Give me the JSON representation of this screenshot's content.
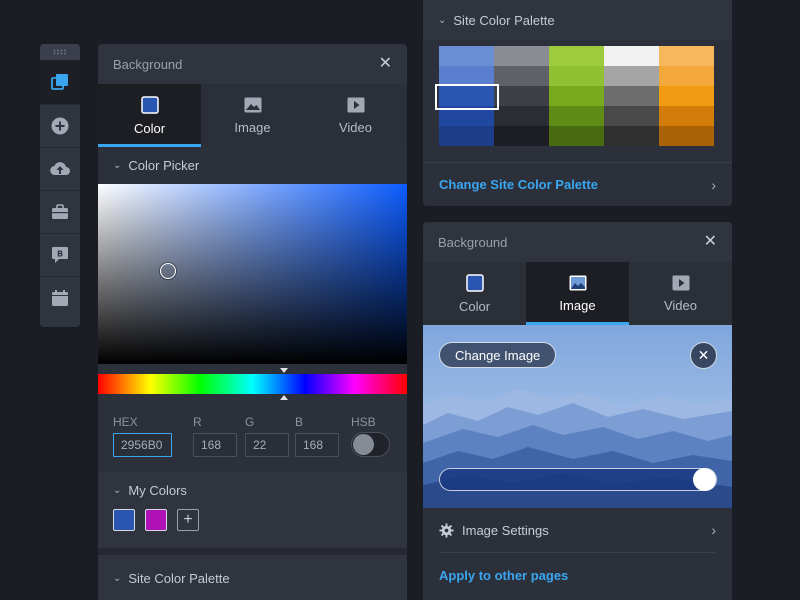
{
  "toolbar": {
    "items": [
      {
        "name": "pages-icon",
        "active": true
      },
      {
        "name": "add-icon"
      },
      {
        "name": "upload-icon"
      },
      {
        "name": "briefcase-icon"
      },
      {
        "name": "blog-icon"
      },
      {
        "name": "calendar-icon"
      }
    ],
    "blog_glyph": "B"
  },
  "left_panel": {
    "title": "Background",
    "tabs": [
      {
        "label": "Color",
        "icon": "color-swatch-icon",
        "active": true
      },
      {
        "label": "Image",
        "icon": "image-icon",
        "active": false
      },
      {
        "label": "Video",
        "icon": "video-icon",
        "active": false
      }
    ],
    "color_picker": {
      "label": "Color Picker",
      "hue_base": "#0c5cff",
      "hex_label": "HEX",
      "hex_value": "2956B0",
      "r_label": "R",
      "r_value": "168",
      "g_label": "G",
      "g_value": "22",
      "b_label": "B",
      "b_value": "168",
      "hsb_label": "HSB",
      "hsb_on": false
    },
    "my_colors": {
      "label": "My Colors",
      "swatches": [
        "#2956b0",
        "#b010b8"
      ],
      "add_glyph": "+"
    },
    "site_palette_label": "Site Color Palette"
  },
  "palette_panel": {
    "title": "Site Color Palette",
    "columns": [
      [
        "#6b8fd4",
        "#5a7fcf",
        "#2956b0",
        "#2148a0",
        "#1b3d8a"
      ],
      [
        "#8a8d93",
        "#5e6168",
        "#3d4047",
        "#2a2d33",
        "#1c1e23"
      ],
      [
        "#9ccc3e",
        "#8fc132",
        "#77aa1f",
        "#5f8c16",
        "#486b10"
      ],
      [
        "#f2f2f2",
        "#a5a5a5",
        "#6d6d6d",
        "#494949",
        "#2f2f2f"
      ],
      [
        "#f6b85a",
        "#f3a83c",
        "#f39a13",
        "#d27d0a",
        "#a96306"
      ]
    ],
    "selected": "#2956b0",
    "link": "Change Site Color Palette"
  },
  "image_panel": {
    "title": "Background",
    "tabs": [
      {
        "label": "Color",
        "icon": "color-swatch-icon",
        "active": false
      },
      {
        "label": "Image",
        "icon": "image-icon",
        "active": true
      },
      {
        "label": "Video",
        "icon": "video-icon",
        "active": false
      }
    ],
    "change_image": "Change Image",
    "overlay_opacity": 1.0,
    "settings": "Image Settings",
    "apply": "Apply to other pages"
  },
  "glyphs": {
    "close": "✕",
    "chevron_down": "⌄",
    "chevron_right": "›"
  }
}
